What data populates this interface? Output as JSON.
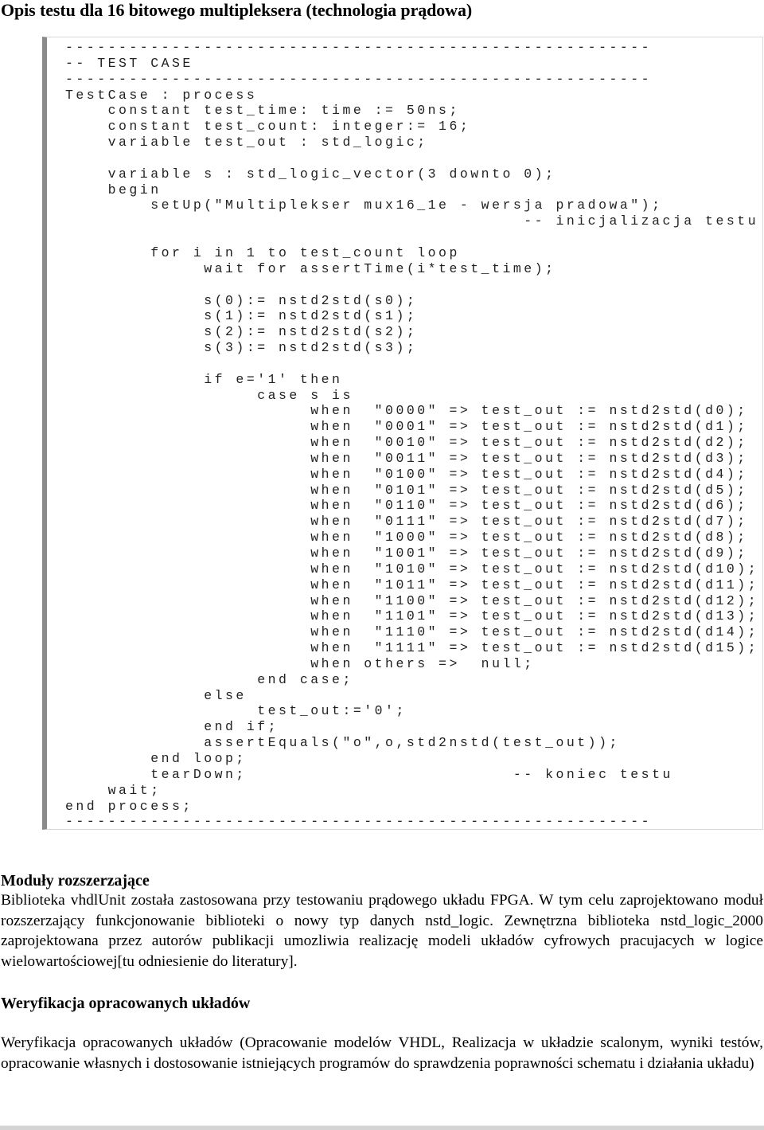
{
  "document": {
    "title": "Opis testu dla 16 bitowego multipleksera (technologia prądowa)"
  },
  "code_listing": {
    "lines": [
      "-------------------------------------------------------",
      "-- TEST CASE",
      "-------------------------------------------------------",
      "TestCase : process",
      "    constant test_time: time := 50ns;",
      "    constant test_count: integer:= 16;",
      "    variable test_out : std_logic;",
      "",
      "    variable s : std_logic_vector(3 downto 0);",
      "    begin",
      "        setUp(\"Multiplekser mux16_1e - wersja pradowa\");",
      "                                           -- inicjalizacja testu",
      "",
      "        for i in 1 to test_count loop",
      "             wait for assertTime(i*test_time);",
      "",
      "             s(0):= nstd2std(s0);",
      "             s(1):= nstd2std(s1);",
      "             s(2):= nstd2std(s2);",
      "             s(3):= nstd2std(s3);",
      "",
      "             if e='1' then",
      "                  case s is",
      "                       when  \"0000\" => test_out := nstd2std(d0);",
      "                       when  \"0001\" => test_out := nstd2std(d1);",
      "                       when  \"0010\" => test_out := nstd2std(d2);",
      "                       when  \"0011\" => test_out := nstd2std(d3);",
      "                       when  \"0100\" => test_out := nstd2std(d4);",
      "                       when  \"0101\" => test_out := nstd2std(d5);",
      "                       when  \"0110\" => test_out := nstd2std(d6);",
      "                       when  \"0111\" => test_out := nstd2std(d7);",
      "                       when  \"1000\" => test_out := nstd2std(d8);",
      "                       when  \"1001\" => test_out := nstd2std(d9);",
      "                       when  \"1010\" => test_out := nstd2std(d10);",
      "                       when  \"1011\" => test_out := nstd2std(d11);",
      "                       when  \"1100\" => test_out := nstd2std(d12);",
      "                       when  \"1101\" => test_out := nstd2std(d13);",
      "                       when  \"1110\" => test_out := nstd2std(d14);",
      "                       when  \"1111\" => test_out := nstd2std(d15);",
      "                       when others =>  null;",
      "                  end case;",
      "             else",
      "                  test_out:='0';",
      "             end if;",
      "             assertEquals(\"o\",o,std2nstd(test_out));",
      "        end loop;",
      "        tearDown;                         -- koniec testu",
      "    wait;",
      "end process;",
      "-------------------------------------------------------"
    ]
  },
  "sections": [
    {
      "heading": "Moduły rozszerzające",
      "paragraph": "Biblioteka vhdlUnit została zastosowana przy testowaniu prądowego układu FPGA. W tym celu zaprojektowano moduł rozszerzający funkcjonowanie biblioteki o nowy typ danych nstd_logic. Zewnętrzna biblioteka nstd_logic_2000 zaprojektowana przez autorów publikacji umozliwia realizację modeli układów cyfrowych pracujacych w logice wielowartościowej[tu odniesienie do literatury]."
    },
    {
      "heading": "Weryfikacja opracowanych układów",
      "paragraph": "Weryfikacja opracowanych układów (Opracowanie modelów VHDL, Realizacja w układzie scalonym, wyniki testów, opracowanie własnych i dostosowanie istniejących programów do sprawdzenia poprawności schematu i działania układu)"
    }
  ]
}
